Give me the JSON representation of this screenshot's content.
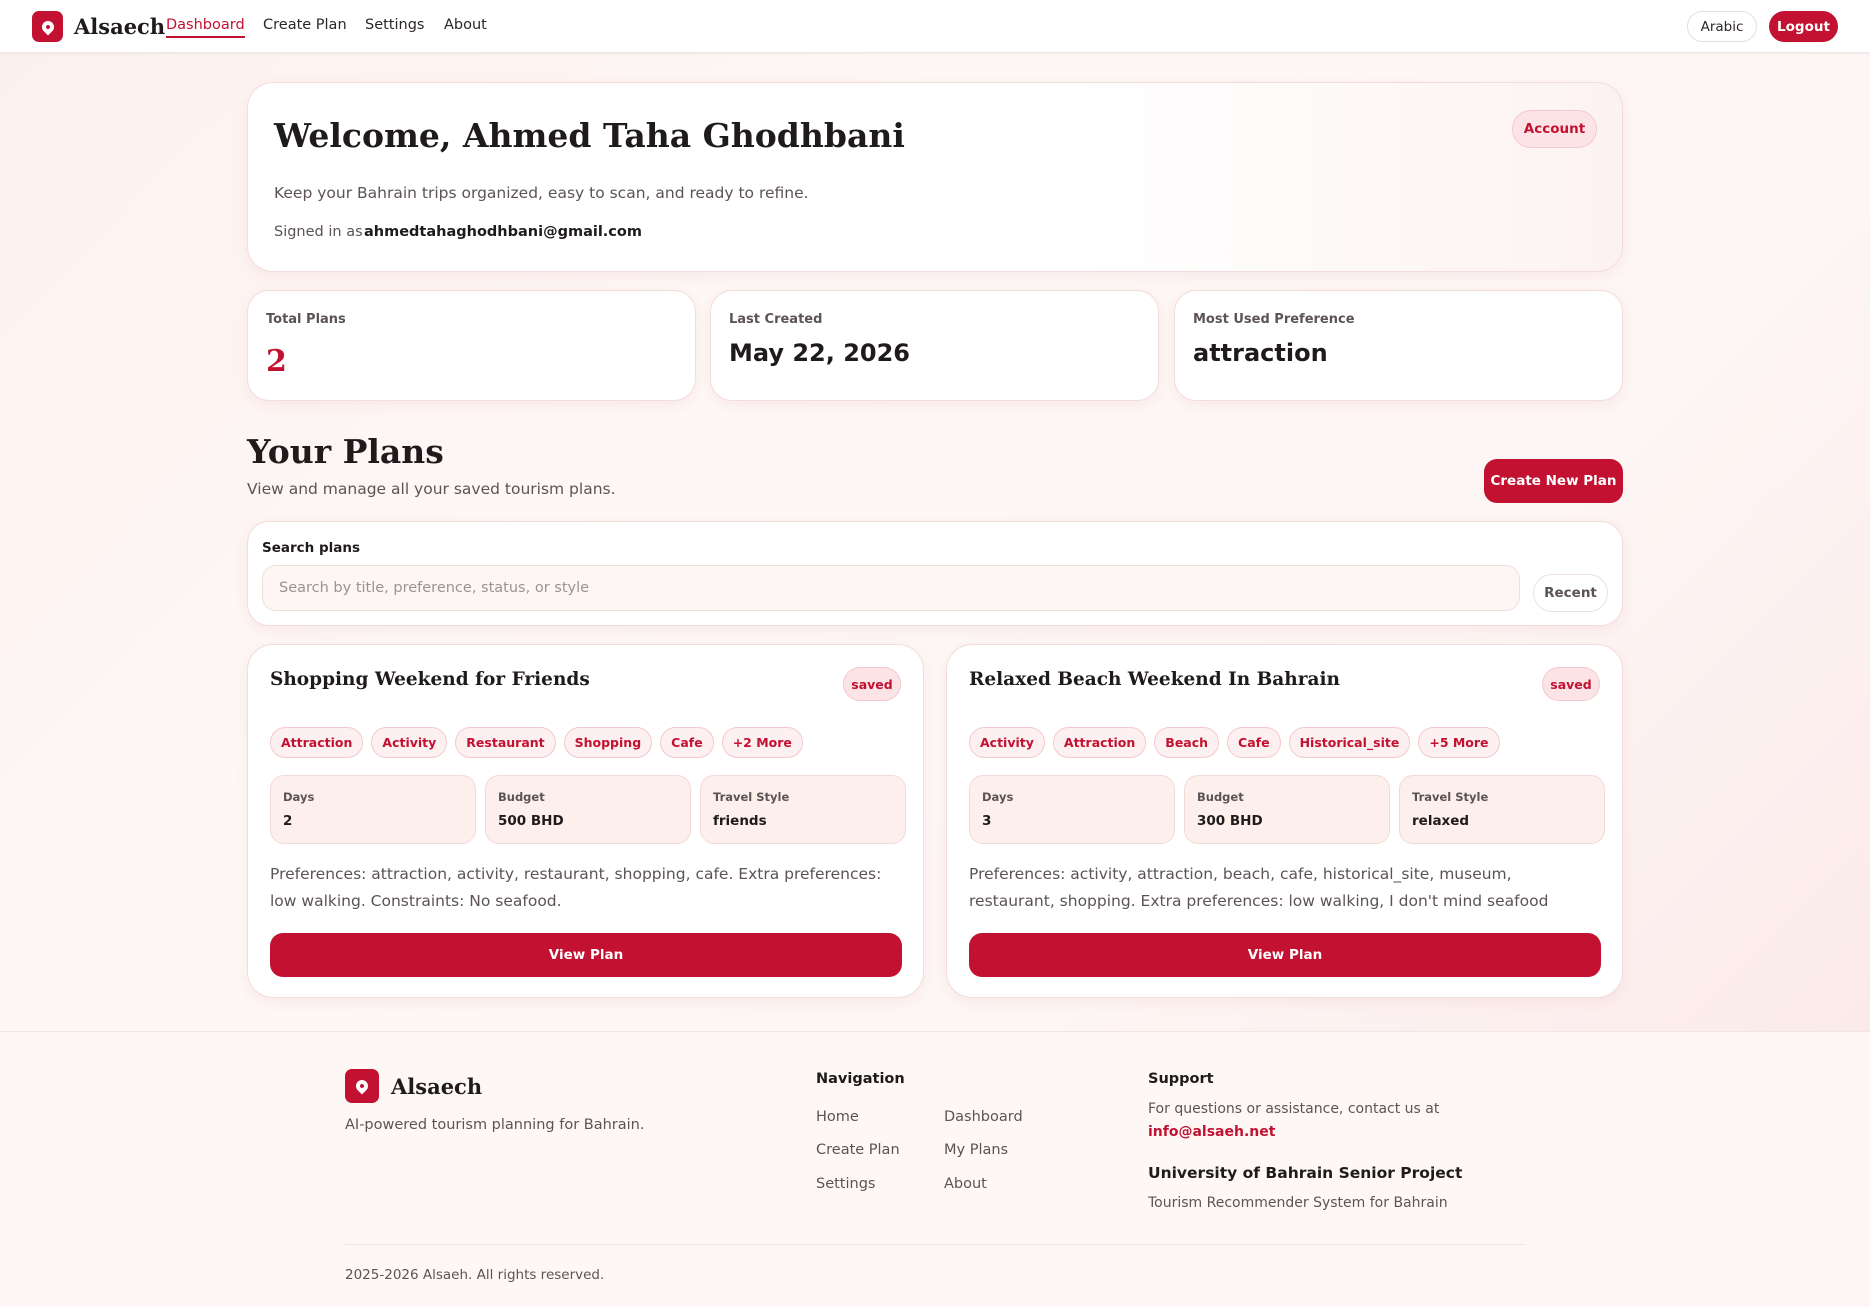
{
  "header": {
    "brand": "Alsaech",
    "nav": [
      "Dashboard",
      "Create Plan",
      "Settings",
      "About"
    ],
    "active_nav": "Dashboard",
    "language_label": "Arabic",
    "logout_label": "Logout"
  },
  "welcome": {
    "title": "Welcome, Ahmed Taha Ghodhbani",
    "subtitle": "Keep your Bahrain trips organized, easy to scan, and ready to refine.",
    "signed_in_label": "Signed in as",
    "email": "ahmedtahaghodhbani@gmail.com",
    "account_label": "Account"
  },
  "stats": [
    {
      "label": "Total Plans",
      "value": "2"
    },
    {
      "label": "Last Created",
      "value": "May 22, 2026"
    },
    {
      "label": "Most Used Preference",
      "value": "attraction"
    }
  ],
  "plans_section": {
    "title": "Your Plans",
    "subtitle": "View and manage all your saved tourism plans.",
    "create_label": "Create New Plan",
    "search_label": "Search plans",
    "search_placeholder": "Search by title, preference, status, or style",
    "sort_label": "Recent"
  },
  "plans": [
    {
      "title": "Shopping Weekend for Friends",
      "status": "saved",
      "tags": [
        "Attraction",
        "Activity",
        "Restaurant",
        "Shopping",
        "Cafe",
        "+2 More"
      ],
      "days_label": "Days",
      "days": "2",
      "budget_label": "Budget",
      "budget": "500 BHD",
      "style_label": "Travel Style",
      "style": "friends",
      "description": "Preferences: attraction, activity, restaurant, shopping, cafe. Extra preferences: low walking. Constraints: No seafood.",
      "button": "View Plan"
    },
    {
      "title": "Relaxed Beach Weekend In Bahrain",
      "status": "saved",
      "tags": [
        "Activity",
        "Attraction",
        "Beach",
        "Cafe",
        "Historical_site",
        "+5 More"
      ],
      "days_label": "Days",
      "days": "3",
      "budget_label": "Budget",
      "budget": "300 BHD",
      "style_label": "Travel Style",
      "style": "relaxed",
      "description": "Preferences: activity, attraction, beach, cafe, historical_site, museum, restaurant, shopping. Extra preferences: low walking, I don't mind seafood",
      "button": "View Plan"
    }
  ],
  "footer": {
    "brand": "Alsaech",
    "tagline": "AI-powered tourism planning for Bahrain.",
    "nav_title": "Navigation",
    "nav_links": [
      "Home",
      "Dashboard",
      "Create Plan",
      "My Plans",
      "Settings",
      "About"
    ],
    "support_title": "Support",
    "support_text": "For questions or assistance, contact us at",
    "support_email": "info@alsaeh.net",
    "project_title": "University of Bahrain Senior Project",
    "project_sub": "Tourism Recommender System for Bahrain",
    "copyright": "2025-2026 Alsaeh. All rights reserved."
  },
  "colors": {
    "accent": "#c21131",
    "background": "#fdf8f6"
  }
}
